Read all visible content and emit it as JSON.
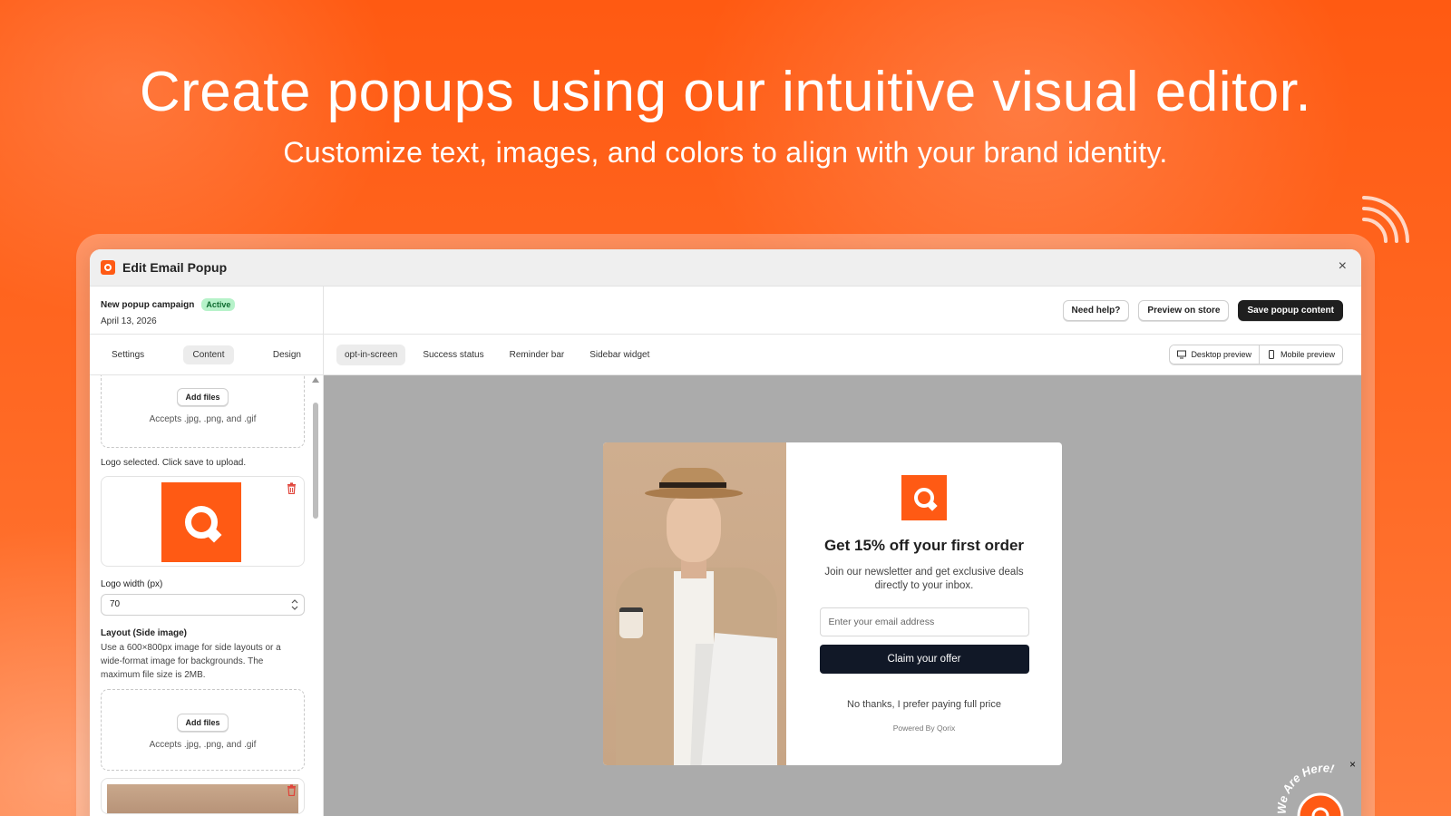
{
  "headline": "Create popups using our intuitive visual editor.",
  "subheadline": "Customize text, images, and colors to align with your brand identity.",
  "window": {
    "title": "Edit Email Popup",
    "close_label": "×"
  },
  "campaign": {
    "name": "New popup campaign",
    "status": "Active",
    "date": "April 13, 2026"
  },
  "sidebar_tabs": [
    "Settings",
    "Content",
    "Design"
  ],
  "upload_top": {
    "button": "Add files",
    "accepts": "Accepts .jpg, .png, and .gif"
  },
  "logo_note": "Logo selected. Click save to upload.",
  "logo_width": {
    "label": "Logo width (px)",
    "value": "70"
  },
  "layout_section": {
    "title": "Layout (Side image)",
    "description": "Use a 600×800px image for side layouts or a wide-format image for backgrounds. The maximum file size is 2MB."
  },
  "upload_bottom": {
    "button": "Add files",
    "accepts": "Accepts .jpg, .png, and .gif"
  },
  "topbar": {
    "help": "Need help?",
    "preview_store": "Preview on store",
    "save": "Save popup content"
  },
  "screen_tabs": [
    "opt-in-screen",
    "Success status",
    "Reminder bar",
    "Sidebar widget"
  ],
  "preview_toggle": {
    "desktop": "Desktop preview",
    "mobile": "Mobile preview"
  },
  "popup": {
    "headline": "Get 15% off your first order",
    "description": "Join our newsletter and get exclusive deals directly to your inbox.",
    "email_placeholder": "Enter your email address",
    "cta": "Claim your offer",
    "decline": "No thanks, I prefer paying full price",
    "powered_by": "Powered By Qorix"
  },
  "widget": {
    "text": "We Are Here!",
    "close_label": "×"
  },
  "colors": {
    "brand": "#ff5a14",
    "cta": "#111827",
    "active_badge": "#b6f2c9"
  }
}
